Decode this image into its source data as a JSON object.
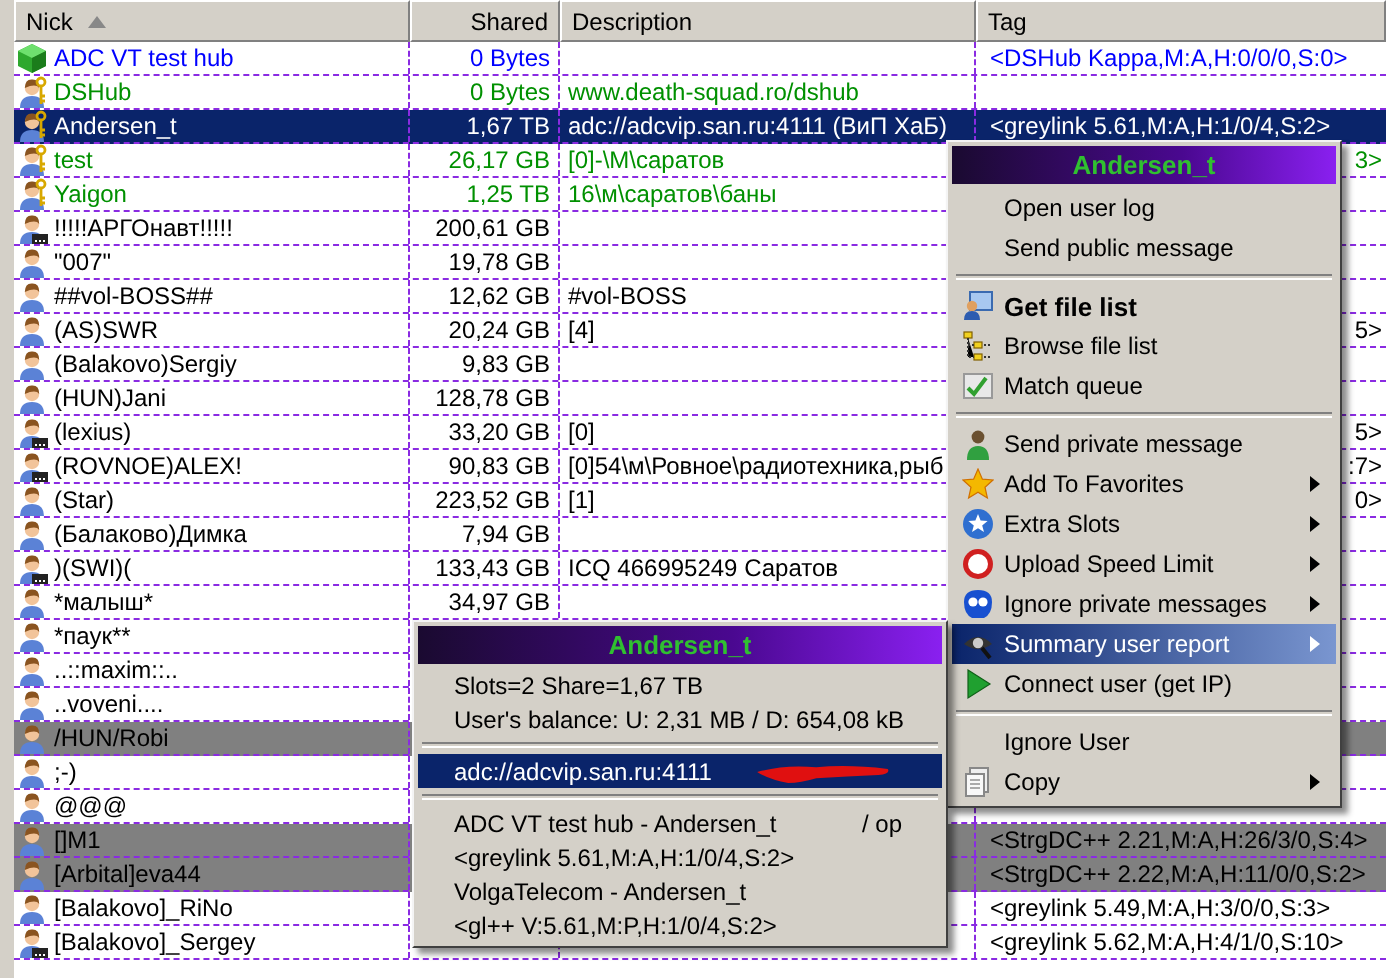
{
  "table": {
    "columns": [
      {
        "label": "Nick",
        "sorted": true
      },
      {
        "label": "Shared"
      },
      {
        "label": "Description"
      },
      {
        "label": "Tag"
      }
    ],
    "rows": [
      {
        "nick": "ADC VT test hub",
        "shared": "0 Bytes",
        "tag": "<DSHub Kappa,M:A,H:0/0/0,S:0>",
        "kind": "hub",
        "selected": false,
        "marked": false
      },
      {
        "nick": "DSHub",
        "shared": "0 Bytes",
        "description": "www.death-squad.ro/dshub",
        "kind": "op",
        "selected": false,
        "marked": false
      },
      {
        "nick": "Andersen_t",
        "shared": "1,67 TB",
        "description": "adc://adcvip.san.ru:4111 (ВиП ХаБ)",
        "tag": "<greylink 5.61,M:A,H:1/0/4,S:2>",
        "kind": "op",
        "selected": true,
        "marked": false
      },
      {
        "nick": "test",
        "shared": "26,17 GB",
        "description": "[0]-\\М\\саратов",
        "tag": "3>",
        "tag_covered": true,
        "kind": "op",
        "selected": false,
        "marked": false
      },
      {
        "nick": "Yaigon",
        "shared": "1,25 TB",
        "description": "16\\м\\саратов\\баны",
        "kind": "op",
        "selected": false,
        "marked": false
      },
      {
        "nick": "!!!!!АРГОнавт!!!!!",
        "shared": "200,61 GB",
        "kind": "passive",
        "selected": false,
        "marked": false
      },
      {
        "nick": "\"007\"",
        "shared": "19,78 GB",
        "kind": "user",
        "selected": false,
        "marked": false
      },
      {
        "nick": "##vol-BOSS##",
        "shared": "12,62 GB",
        "description": "#vol-BOSS",
        "kind": "user",
        "selected": false,
        "marked": false
      },
      {
        "nick": "(AS)SWR",
        "shared": "20,24 GB",
        "description": "[4]",
        "tag": "5>",
        "tag_covered": true,
        "kind": "user",
        "selected": false,
        "marked": false
      },
      {
        "nick": "(Balakovo)Sergiy",
        "shared": "9,83 GB",
        "kind": "user",
        "selected": false,
        "marked": false
      },
      {
        "nick": "(HUN)Jani",
        "shared": "128,78 GB",
        "kind": "user",
        "selected": false,
        "marked": false
      },
      {
        "nick": "(lexius)",
        "shared": "33,20 GB",
        "description": "[0]",
        "tag": "5>",
        "tag_covered": true,
        "kind": "passive",
        "selected": false,
        "marked": false
      },
      {
        "nick": "(ROVNOE)ALEX!",
        "shared": "90,83 GB",
        "description": "[0]54\\м\\Ровное\\радиотехника,рыб",
        "tag": ":7>",
        "tag_covered": true,
        "kind": "passive",
        "selected": false,
        "marked": false
      },
      {
        "nick": "(Star)",
        "shared": "223,52 GB",
        "description": "[1]",
        "tag": "0>",
        "tag_covered": true,
        "kind": "user",
        "selected": false,
        "marked": false
      },
      {
        "nick": "(Балаково)Димка",
        "shared": "7,94 GB",
        "kind": "user",
        "selected": false,
        "marked": false
      },
      {
        "nick": ")(SWI)(",
        "shared": "133,43 GB",
        "description": "ICQ 466995249 Саратов",
        "kind": "passive",
        "selected": false,
        "marked": false
      },
      {
        "nick": "*малыш*",
        "shared": "34,97 GB",
        "kind": "user",
        "selected": false,
        "marked": false
      },
      {
        "nick": "*паук**",
        "kind": "user",
        "selected": false,
        "marked": false
      },
      {
        "nick": "..::maxim::..",
        "kind": "user",
        "selected": false,
        "marked": false
      },
      {
        "nick": "..voveni....",
        "kind": "user",
        "selected": false,
        "marked": false
      },
      {
        "nick": "/HUN/Robi",
        "kind": "user",
        "selected": false,
        "marked": true
      },
      {
        "nick": ";-)",
        "kind": "user",
        "selected": false,
        "marked": false
      },
      {
        "nick": "@@@",
        "kind": "user",
        "selected": false,
        "marked": false
      },
      {
        "nick": "[]M1",
        "tag": "<StrgDC++ 2.21,M:A,H:26/3/0,S:4>",
        "kind": "user",
        "selected": false,
        "marked": true
      },
      {
        "nick": "[Arbital]eva44",
        "tag": "<StrgDC++ 2.22,M:A,H:11/0/0,S:2>",
        "kind": "user",
        "selected": false,
        "marked": true
      },
      {
        "nick": "[Balakovo]_RiNo",
        "tag": "<greylink 5.49,M:A,H:3/0/0,S:3>",
        "kind": "user",
        "selected": false,
        "marked": false
      },
      {
        "nick": "[Balakovo]_Sergey",
        "tag": "<greylink 5.62,M:A,H:4/1/0,S:10>",
        "kind": "passive",
        "selected": false,
        "marked": false
      }
    ]
  },
  "context_menu": {
    "title": "Andersen_t",
    "items": [
      {
        "kind": "item",
        "label": "Open user log",
        "selected": false
      },
      {
        "kind": "item",
        "label": "Send public message",
        "selected": false
      },
      {
        "kind": "separator"
      },
      {
        "kind": "item",
        "label": "Get file list",
        "default": true,
        "selected": false
      },
      {
        "kind": "item",
        "label": "Browse file list",
        "selected": false
      },
      {
        "kind": "item",
        "label": "Match queue",
        "selected": false
      },
      {
        "kind": "separator"
      },
      {
        "kind": "item",
        "label": "Send private message",
        "selected": false
      },
      {
        "kind": "item",
        "label": "Add To Favorites",
        "submenu": true,
        "selected": false
      },
      {
        "kind": "item",
        "label": "Extra Slots",
        "submenu": true,
        "selected": false
      },
      {
        "kind": "item",
        "label": "Upload Speed Limit",
        "submenu": true,
        "selected": false
      },
      {
        "kind": "item",
        "label": "Ignore private messages",
        "submenu": true,
        "selected": false
      },
      {
        "kind": "item",
        "label": "Summary user report",
        "submenu": true,
        "selected": true
      },
      {
        "kind": "item",
        "label": "Connect user (get IP)",
        "selected": false
      },
      {
        "kind": "separator"
      },
      {
        "kind": "item",
        "label": "Ignore User",
        "selected": false
      },
      {
        "kind": "item",
        "label": "Copy",
        "submenu": true,
        "selected": false
      }
    ]
  },
  "report_menu": {
    "title": "Andersen_t",
    "items": [
      {
        "kind": "item",
        "label": "Slots=2 Share=1,67 TB",
        "selected": false
      },
      {
        "kind": "item",
        "label": "User's balance: U: 2,31 MB / D: 654,08 kB",
        "selected": false
      },
      {
        "kind": "separator"
      },
      {
        "kind": "item",
        "label": "adc://adcvip.san.ru:4111",
        "selected": true
      },
      {
        "kind": "separator"
      },
      {
        "kind": "item",
        "label": "ADC VT test hub - Andersen_t",
        "right": "/ op",
        "selected": false
      },
      {
        "kind": "item",
        "label": "<greylink 5.61,M:A,H:1/0/4,S:2>",
        "selected": false
      },
      {
        "kind": "item",
        "label": "VolgaTelecom - Andersen_t",
        "selected": false
      },
      {
        "kind": "item",
        "label": "<gl++ V:5.61,M:P,H:1/0/4,S:2>",
        "selected": false
      }
    ]
  }
}
